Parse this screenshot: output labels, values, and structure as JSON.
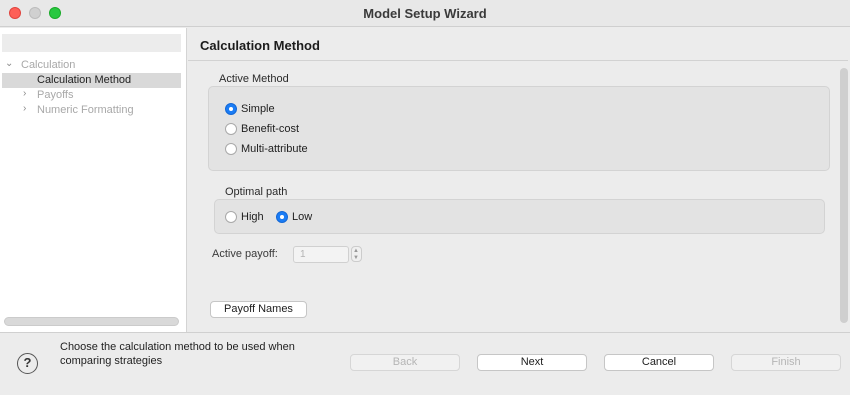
{
  "window": {
    "title": "Model Setup Wizard"
  },
  "sidebar": {
    "items": [
      {
        "label": "Calculation",
        "expanded": true
      },
      {
        "label": "Calculation Method",
        "selected": true
      },
      {
        "label": "Payoffs",
        "expandable": true
      },
      {
        "label": "Numeric Formatting",
        "expandable": true
      }
    ]
  },
  "content": {
    "heading": "Calculation Method",
    "active_method": {
      "label": "Active Method",
      "options": [
        "Simple",
        "Benefit-cost",
        "Multi-attribute"
      ],
      "selected": "Simple"
    },
    "optimal_path": {
      "label": "Optimal path",
      "options": [
        "High",
        "Low"
      ],
      "selected": "Low"
    },
    "active_payoff": {
      "label": "Active payoff:",
      "value": "1"
    },
    "payoff_names_button": "Payoff Names"
  },
  "footer": {
    "help_icon": "?",
    "description_lines": [
      "Choose the calculation method to be used when",
      "comparing strategies"
    ],
    "buttons": {
      "back": "Back",
      "next": "Next",
      "cancel": "Cancel",
      "finish": "Finish"
    }
  },
  "colors": {
    "accent": "#1a7cf5",
    "close": "#fe5f57",
    "maximize": "#28c840"
  }
}
